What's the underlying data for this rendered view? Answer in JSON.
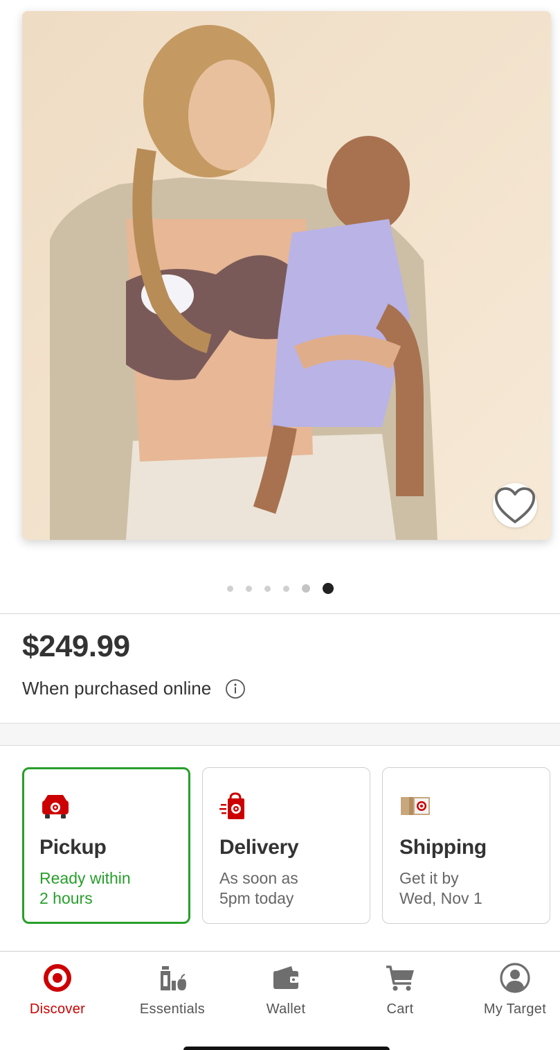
{
  "product": {
    "price": "$249.99",
    "price_note": "When purchased online",
    "carousel": {
      "total": 6,
      "active_index": 5
    }
  },
  "fulfillment": [
    {
      "title": "Pickup",
      "line1": "Ready within",
      "line2": "2 hours",
      "selected": true,
      "icon": "store-pickup-icon"
    },
    {
      "title": "Delivery",
      "line1": "As soon as",
      "line2": "5pm today",
      "selected": false,
      "icon": "delivery-bag-icon"
    },
    {
      "title": "Shipping",
      "line1": "Get it by",
      "line2": "Wed, Nov 1",
      "selected": false,
      "icon": "shipping-box-icon"
    }
  ],
  "nav": {
    "items": [
      {
        "label": "Discover",
        "icon": "target-bullseye-icon",
        "active": true
      },
      {
        "label": "Essentials",
        "icon": "essentials-icon",
        "active": false
      },
      {
        "label": "Wallet",
        "icon": "wallet-icon",
        "active": false
      },
      {
        "label": "Cart",
        "icon": "cart-icon",
        "active": false
      },
      {
        "label": "My Target",
        "icon": "account-icon",
        "active": false
      }
    ]
  },
  "colors": {
    "brand_red": "#cc0000",
    "pickup_green": "#279f2a",
    "text_dark": "#333333",
    "text_gray": "#666666"
  }
}
